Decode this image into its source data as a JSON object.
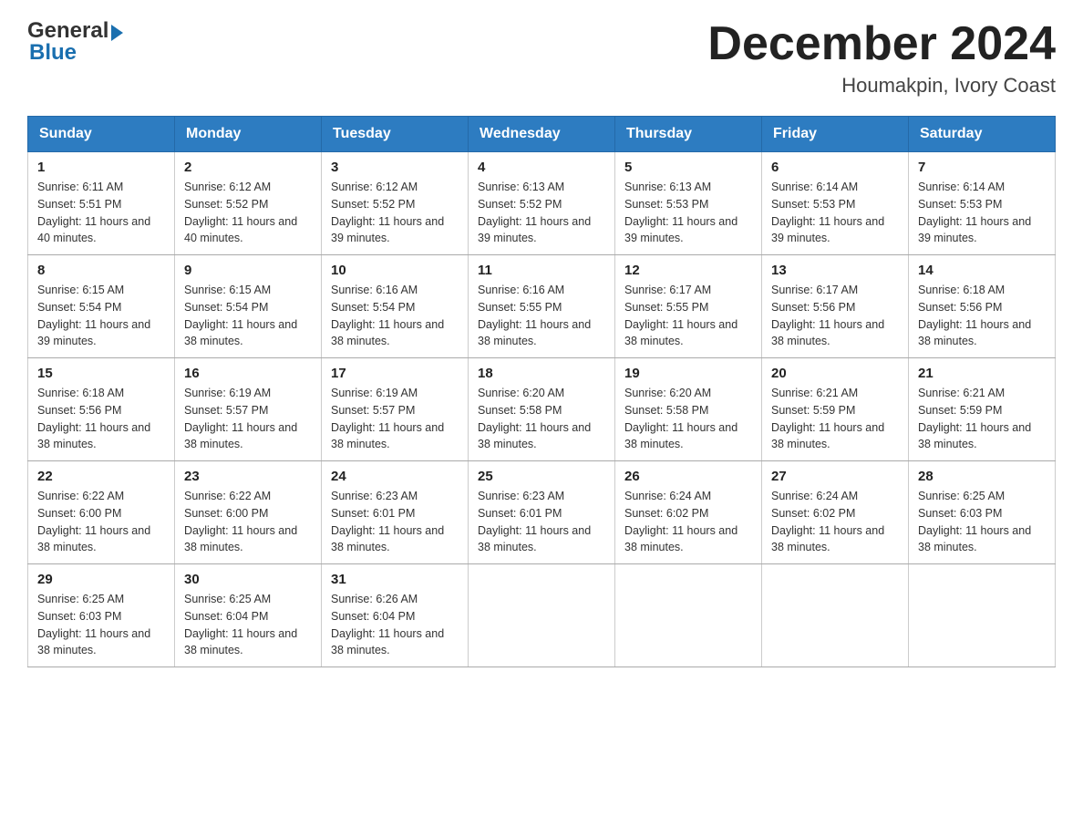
{
  "header": {
    "logo": {
      "text_general": "General",
      "text_blue": "Blue",
      "arrow": "▶"
    },
    "title": "December 2024",
    "location": "Houmakpin, Ivory Coast"
  },
  "days_of_week": [
    "Sunday",
    "Monday",
    "Tuesday",
    "Wednesday",
    "Thursday",
    "Friday",
    "Saturday"
  ],
  "weeks": [
    [
      {
        "day": "1",
        "sunrise": "6:11 AM",
        "sunset": "5:51 PM",
        "daylight": "11 hours and 40 minutes."
      },
      {
        "day": "2",
        "sunrise": "6:12 AM",
        "sunset": "5:52 PM",
        "daylight": "11 hours and 40 minutes."
      },
      {
        "day": "3",
        "sunrise": "6:12 AM",
        "sunset": "5:52 PM",
        "daylight": "11 hours and 39 minutes."
      },
      {
        "day": "4",
        "sunrise": "6:13 AM",
        "sunset": "5:52 PM",
        "daylight": "11 hours and 39 minutes."
      },
      {
        "day": "5",
        "sunrise": "6:13 AM",
        "sunset": "5:53 PM",
        "daylight": "11 hours and 39 minutes."
      },
      {
        "day": "6",
        "sunrise": "6:14 AM",
        "sunset": "5:53 PM",
        "daylight": "11 hours and 39 minutes."
      },
      {
        "day": "7",
        "sunrise": "6:14 AM",
        "sunset": "5:53 PM",
        "daylight": "11 hours and 39 minutes."
      }
    ],
    [
      {
        "day": "8",
        "sunrise": "6:15 AM",
        "sunset": "5:54 PM",
        "daylight": "11 hours and 39 minutes."
      },
      {
        "day": "9",
        "sunrise": "6:15 AM",
        "sunset": "5:54 PM",
        "daylight": "11 hours and 38 minutes."
      },
      {
        "day": "10",
        "sunrise": "6:16 AM",
        "sunset": "5:54 PM",
        "daylight": "11 hours and 38 minutes."
      },
      {
        "day": "11",
        "sunrise": "6:16 AM",
        "sunset": "5:55 PM",
        "daylight": "11 hours and 38 minutes."
      },
      {
        "day": "12",
        "sunrise": "6:17 AM",
        "sunset": "5:55 PM",
        "daylight": "11 hours and 38 minutes."
      },
      {
        "day": "13",
        "sunrise": "6:17 AM",
        "sunset": "5:56 PM",
        "daylight": "11 hours and 38 minutes."
      },
      {
        "day": "14",
        "sunrise": "6:18 AM",
        "sunset": "5:56 PM",
        "daylight": "11 hours and 38 minutes."
      }
    ],
    [
      {
        "day": "15",
        "sunrise": "6:18 AM",
        "sunset": "5:56 PM",
        "daylight": "11 hours and 38 minutes."
      },
      {
        "day": "16",
        "sunrise": "6:19 AM",
        "sunset": "5:57 PM",
        "daylight": "11 hours and 38 minutes."
      },
      {
        "day": "17",
        "sunrise": "6:19 AM",
        "sunset": "5:57 PM",
        "daylight": "11 hours and 38 minutes."
      },
      {
        "day": "18",
        "sunrise": "6:20 AM",
        "sunset": "5:58 PM",
        "daylight": "11 hours and 38 minutes."
      },
      {
        "day": "19",
        "sunrise": "6:20 AM",
        "sunset": "5:58 PM",
        "daylight": "11 hours and 38 minutes."
      },
      {
        "day": "20",
        "sunrise": "6:21 AM",
        "sunset": "5:59 PM",
        "daylight": "11 hours and 38 minutes."
      },
      {
        "day": "21",
        "sunrise": "6:21 AM",
        "sunset": "5:59 PM",
        "daylight": "11 hours and 38 minutes."
      }
    ],
    [
      {
        "day": "22",
        "sunrise": "6:22 AM",
        "sunset": "6:00 PM",
        "daylight": "11 hours and 38 minutes."
      },
      {
        "day": "23",
        "sunrise": "6:22 AM",
        "sunset": "6:00 PM",
        "daylight": "11 hours and 38 minutes."
      },
      {
        "day": "24",
        "sunrise": "6:23 AM",
        "sunset": "6:01 PM",
        "daylight": "11 hours and 38 minutes."
      },
      {
        "day": "25",
        "sunrise": "6:23 AM",
        "sunset": "6:01 PM",
        "daylight": "11 hours and 38 minutes."
      },
      {
        "day": "26",
        "sunrise": "6:24 AM",
        "sunset": "6:02 PM",
        "daylight": "11 hours and 38 minutes."
      },
      {
        "day": "27",
        "sunrise": "6:24 AM",
        "sunset": "6:02 PM",
        "daylight": "11 hours and 38 minutes."
      },
      {
        "day": "28",
        "sunrise": "6:25 AM",
        "sunset": "6:03 PM",
        "daylight": "11 hours and 38 minutes."
      }
    ],
    [
      {
        "day": "29",
        "sunrise": "6:25 AM",
        "sunset": "6:03 PM",
        "daylight": "11 hours and 38 minutes."
      },
      {
        "day": "30",
        "sunrise": "6:25 AM",
        "sunset": "6:04 PM",
        "daylight": "11 hours and 38 minutes."
      },
      {
        "day": "31",
        "sunrise": "6:26 AM",
        "sunset": "6:04 PM",
        "daylight": "11 hours and 38 minutes."
      },
      null,
      null,
      null,
      null
    ]
  ],
  "labels": {
    "sunrise_prefix": "Sunrise: ",
    "sunset_prefix": "Sunset: ",
    "daylight_prefix": "Daylight: "
  }
}
